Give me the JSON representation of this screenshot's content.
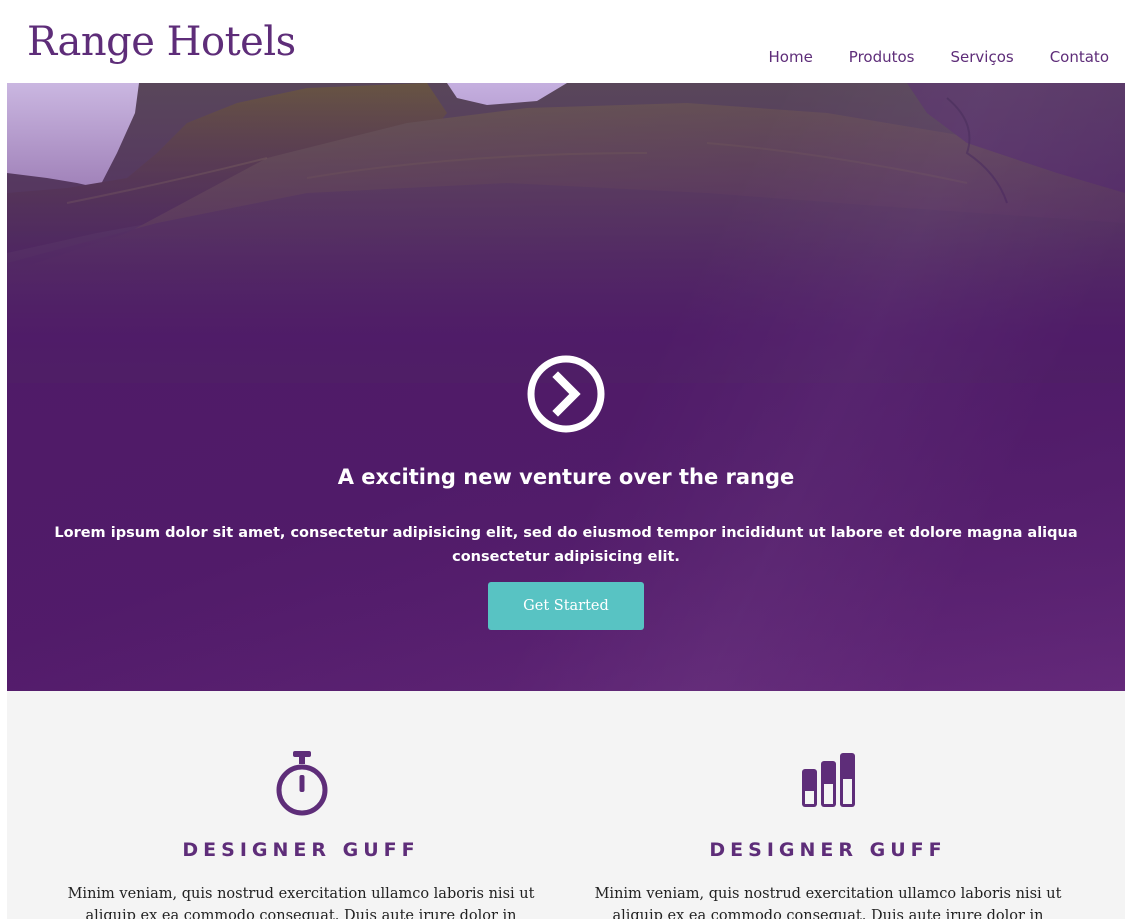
{
  "header": {
    "logo": "Range Hotels",
    "nav": [
      "Home",
      "Produtos",
      "Serviços",
      "Contato"
    ]
  },
  "hero": {
    "icon": "chevron-right-circle-icon",
    "title": "A exciting new venture over the range",
    "text": "Lorem ipsum dolor sit amet, consectetur adipisicing elit, sed do eiusmod tempor incididunt ut labore et dolore magna aliqua consectetur adipisicing elit.",
    "button": "Get Started"
  },
  "features": [
    {
      "icon": "stopwatch-icon",
      "title": "DESIGNER GUFF",
      "text": "Minim veniam, quis nostrud exercitation ullamco laboris nisi ut aliquip ex ea commodo consequat. Duis aute irure dolor in reprehenderit in"
    },
    {
      "icon": "bar-chart-icon",
      "title": "DESIGNER GUFF",
      "text": "Minim veniam, quis nostrud exercitation ullamco laboris nisi ut aliquip ex ea commodo consequat. Duis aute irure dolor in reprehenderit in"
    }
  ],
  "colors": {
    "brand": "#5e2d79",
    "hero_overlay": "#521b6a",
    "button": "#58c3c3",
    "features_bg": "#f4f4f4"
  }
}
